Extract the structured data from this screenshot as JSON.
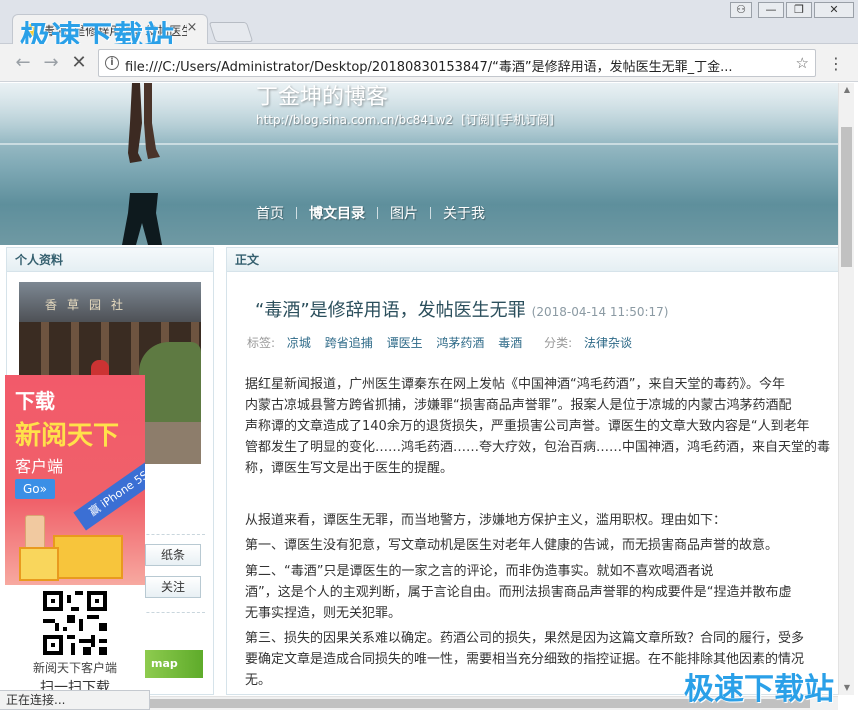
{
  "watermarks": {
    "top": "极速下载站",
    "bottom": "极速下载站"
  },
  "browser": {
    "tab_title": "毒酒”是修辞用语，发帖医生",
    "tab_close": "×",
    "window_controls": {
      "user": "⚇",
      "minimize": "—",
      "restore": "❐",
      "close": "✕"
    },
    "url": "file:///C:/Users/Administrator/Desktop/20180830153847/“毒酒”是修辞用语，发帖医生无罪_丁金...",
    "status": "正在连接..."
  },
  "blog": {
    "title": "丁金坤的博客",
    "url": "http://blog.sina.com.cn/bc841w2",
    "subscribe": "[订阅]",
    "mobile_subscribe": "[手机订阅]",
    "nav": [
      "首页",
      "博文目录",
      "图片",
      "关于我"
    ]
  },
  "sidebar": {
    "title": "个人资料",
    "photo_sign": "香草园社",
    "btn1": "纸条",
    "btn2": "关注",
    "map_label": "map"
  },
  "main": {
    "panel_title": "正文",
    "article_title": "“毒酒”是修辞用语，发帖医生无罪",
    "article_date": "(2018-04-14 11:50:17)",
    "tags_label": "标签:",
    "tags": [
      "凉城",
      "跨省追捕",
      "谭医生",
      "鸿茅药酒",
      "毒酒"
    ],
    "category_label": "分类:",
    "category": "法律杂谈",
    "paragraphs": [
      "据红星新闻报道，广州医生谭秦东在网上发帖《中国神酒“鸿毛药酒”，来自天堂的毒药》。今年",
      "内蒙古凉城县警方跨省抓捕，涉嫌罪“损害商品声誉罪”。报案人是位于凉城的内蒙古鸿茅药酒配",
      "声称谭的文章造成了140余万的退货损失，严重损害公司声誉。谭医生的文章大致内容是“人到老年",
      "管都发生了明显的变化……鸿毛药酒……夸大疗效，包治百病……中国神酒，鸿毛药酒，来自天堂的毒",
      "称，谭医生写文是出于医生的提醒。",
      "从报道来看，谭医生无罪，而当地警方，涉嫌地方保护主义，滥用职权。理由如下：",
      "第一、谭医生没有犯意，写文章动机是医生对老年人健康的告诫，而无损害商品声誉的故意。",
      "第二、“毒酒”只是谭医生的一家之言的评论，而非伪造事实。就如不喜欢喝酒者说",
      "酒”，这是个人的主观判断，属于言论自由。而刑法损害商品声誉罪的构成要件是“捏造并散布虚",
      "无事实捏造，则无关犯罪。",
      "第三、损失的因果关系难以确定。药酒公司的损失，果然是因为这篇文章所致？合同的履行，受多",
      "要确定文章是造成合同损失的唯一性，需要相当充分细致的指控证据。在不能排除其他因素的情况",
      "无。"
    ]
  },
  "ad": {
    "line1": "下载",
    "line2": "新阅天下",
    "line3": "客户端",
    "go": "Go»",
    "ribbon": "赢 iPhone 5S",
    "qr_caption": "新阅天下客户端",
    "qr_caption2": "扫一扫下载"
  }
}
